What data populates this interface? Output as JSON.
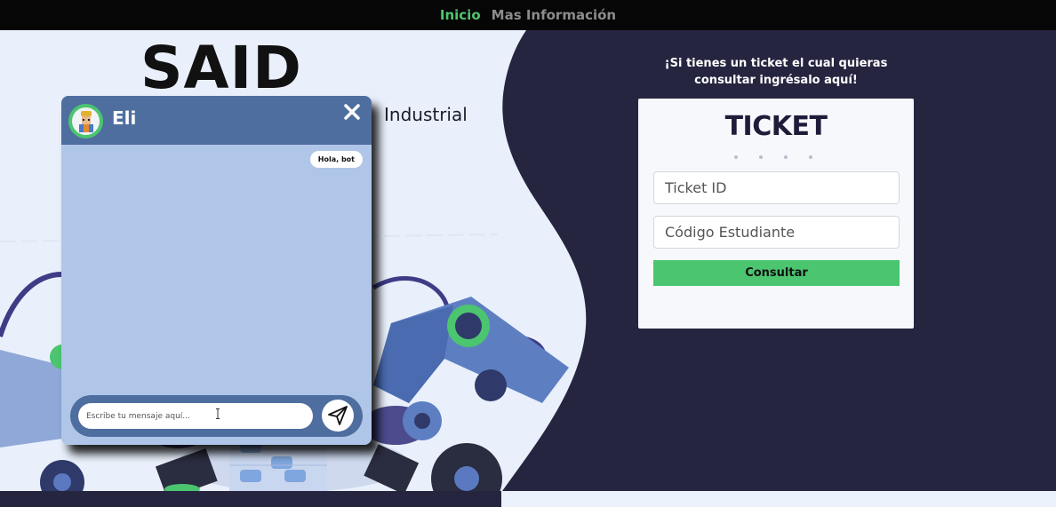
{
  "nav": {
    "items": [
      {
        "label": "Inicio",
        "active": true
      },
      {
        "label": "Mas Información",
        "active": false
      }
    ]
  },
  "hero": {
    "title": "SAID",
    "subtitle": "Industrial"
  },
  "ticket_panel": {
    "prompt": "¡Si tienes un ticket el cual quieras consultar ingrésalo aquí!",
    "heading": "TICKET",
    "ticket_id_placeholder": "Ticket ID",
    "student_code_placeholder": "Código Estudiante",
    "submit_label": "Consultar"
  },
  "chatbot": {
    "bot_name": "Eli",
    "messages": [
      {
        "sender": "user",
        "text": "Hola, bot"
      }
    ],
    "input_placeholder": "Escribe tu mensaje aquí..."
  },
  "colors": {
    "accent_green": "#4bc56f",
    "navy": "#262540",
    "chat_header": "#4f6ea0",
    "chat_body": "#b0c6e8"
  },
  "icons": [
    "close-icon",
    "send-icon",
    "bot-avatar-icon"
  ]
}
